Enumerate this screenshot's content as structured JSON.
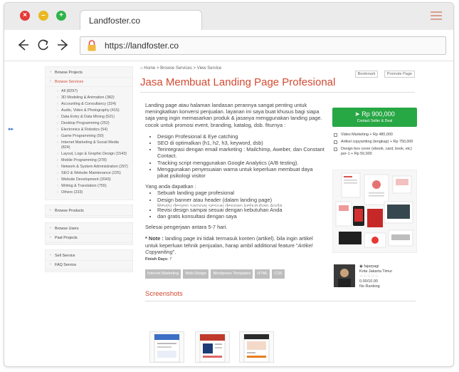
{
  "browser": {
    "tab_title": "Landfoster.co",
    "url": "https://landfoster.co"
  },
  "sidebar": {
    "sections": [
      {
        "label": "Browse Projects",
        "active": false,
        "items": []
      },
      {
        "label": "Browse Services",
        "active": true,
        "items": [
          "All (8297)",
          "3D Modeling & Animation (382)",
          "Accounting & Consultancy (324)",
          "Audio, Video & Photography (415)",
          "Data Entry & Data Mining (521)",
          "Desktop Programming (252)",
          "Electronics & Robotics (54)",
          "Game Programming (50)",
          "Internet Marketing & Social Media (824)",
          "Layout, Logo & Graphic Design (1543)",
          "Mobile Programming (378)",
          "Network & System Administration (297)",
          "SEO & Website Maintenance (225)",
          "Website Development (2043)",
          "Writing & Translation (755)",
          "Others (233)"
        ]
      },
      {
        "label": "Browse Products",
        "active": false,
        "items": []
      },
      {
        "label": "Browse Users",
        "active": false,
        "items": []
      },
      {
        "label": "Past Projects",
        "active": false,
        "items": []
      },
      {
        "label": "Sell Service",
        "active": false,
        "items": []
      },
      {
        "label": "FAQ Service",
        "active": false,
        "items": []
      }
    ]
  },
  "breadcrumb": {
    "home": "Home",
    "section": "Browse Services",
    "current": "View Service",
    "bookmark_label": "Bookmark",
    "promote_label": "Promote Page"
  },
  "service": {
    "title": "Jasa Membuat Landing Page Profesional",
    "intro": "Landing page atau halaman landasan perannya sangat penting untuk meningkatkan konversi penjualan. layanan ini saya buat khusus bagi siapa saja yang ingin memasarkan produk & jasanya menggunakan landing page. cocok untuk promosi event, branding, katalog, dsb. fiturnya :",
    "features": [
      "Design Profesional & Eye catching",
      "SEO di optimalkan (h1, h2, h3, keyword, dsb)",
      "Terintegrasi dengan email marketing : Mailchimp, Aweber, dan Constant Contact.",
      "Tracking script menggunakan Google Analytics (A/B testing).",
      "Menggunakan penyesuaian warna untuk keperluan membuat daya pikat psikologi visitor"
    ],
    "deliverables_heading": "Yang anda dapatkan :",
    "deliverables": [
      "Sebuah landing page profesional",
      "Design banner atau header (dalam landing page)",
      "Revisi design sampai sesuai dengan kebutuhan Anda",
      "Revisi design sampai sesuai dengan kebutuhan Anda",
      "dan gratis konsultasi dengan saya"
    ],
    "timeline": "Selesai pengerjaan antara 5-7 hari.",
    "note_label": "* Note :",
    "note_text": "landing page ini tidak termasuk konten (artikel). bila ingin artikel untuk keperluan tehnik penjualan, harap ambil additional feature \"",
    "note_italic": "Artikel Copywriting",
    "note_end": "\".",
    "finish_label": "Finish Days:",
    "finish_value": "7",
    "tags": [
      "Internet Marketing",
      "Web Design",
      "Wordpress Templates",
      "HTML",
      "CSS"
    ],
    "screenshots_heading": "Screenshots"
  },
  "purchase": {
    "price": "Rp 900,000",
    "button_sub": "Contact Seller & Deal",
    "options": [
      "Video Marketing + Rp 480,000",
      "Artikel copywriting (lengkap) + Rp 750,000",
      "Design box cover (ebook, card, book, etc) per-1 + Rp 50,000"
    ]
  },
  "seller": {
    "username": "fajarpagi",
    "location": "Kota Jakarta Timur",
    "rating": "0.00/10.00",
    "ranking": "No Ranking"
  },
  "colors": {
    "accent": "#d34a32",
    "buy": "#28a745"
  }
}
